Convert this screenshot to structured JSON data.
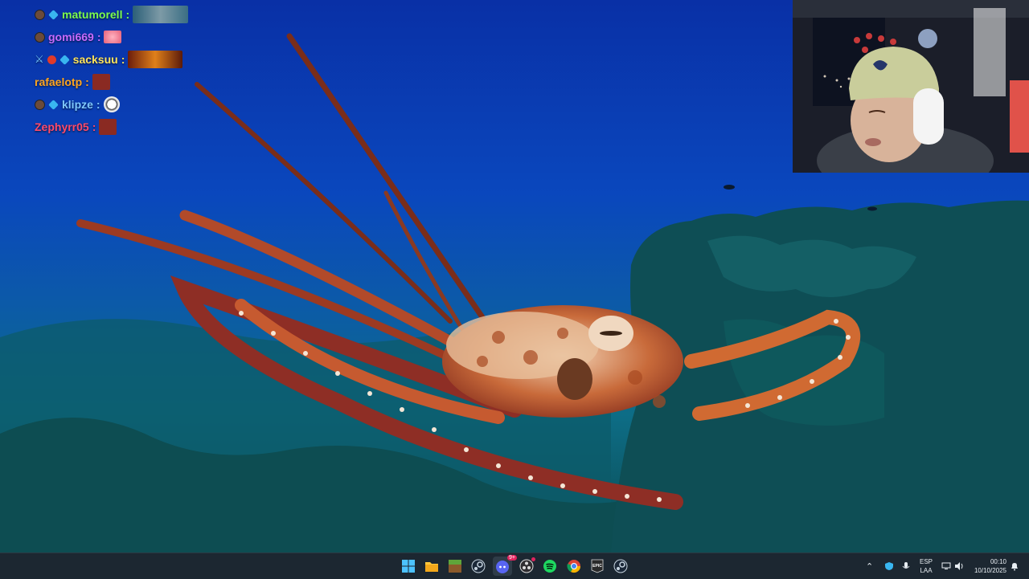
{
  "chat": {
    "messages": [
      {
        "user": "matumorell",
        "color": "#7cff4f",
        "suffix": ":",
        "badges": [
          "sub",
          "cube"
        ],
        "emote": "wide"
      },
      {
        "user": "gomi669",
        "color": "#c86bff",
        "suffix": ":",
        "badges": [
          "sub"
        ],
        "emote": "small-pink"
      },
      {
        "user": "sacksuu",
        "color": "#ffe45c",
        "suffix": ":",
        "badges": [
          "sword",
          "red",
          "cube"
        ],
        "emote": "wide-fire"
      },
      {
        "user": "rafaelotp",
        "color": "#ffa51f",
        "suffix": ":",
        "badges": [],
        "emote": "small-red"
      },
      {
        "user": "klipze",
        "color": "#7ec8ff",
        "suffix": ":",
        "badges": [
          "sub",
          "cube"
        ],
        "emote": "small-panda"
      },
      {
        "user": "Zephyrr05",
        "color": "#ff4a6a",
        "suffix": ":",
        "badges": [],
        "emote": "small-red"
      }
    ]
  },
  "taskbar": {
    "apps": [
      {
        "name": "start-button",
        "icon": "windows-icon"
      },
      {
        "name": "file-explorer",
        "icon": "folder-icon"
      },
      {
        "name": "minecraft",
        "icon": "grass-block-icon"
      },
      {
        "name": "steam",
        "icon": "steam-icon"
      },
      {
        "name": "discord",
        "icon": "discord-icon",
        "badge": "9+"
      },
      {
        "name": "obs",
        "icon": "obs-icon"
      },
      {
        "name": "spotify",
        "icon": "spotify-icon"
      },
      {
        "name": "chrome",
        "icon": "chrome-icon"
      },
      {
        "name": "epic-games",
        "icon": "epic-icon",
        "label": "EPIC"
      },
      {
        "name": "steam-2",
        "icon": "steam-icon"
      }
    ],
    "tray": {
      "language": "ESP",
      "layout": "LAA",
      "time": "00:10",
      "date": "10/10/2025"
    }
  }
}
